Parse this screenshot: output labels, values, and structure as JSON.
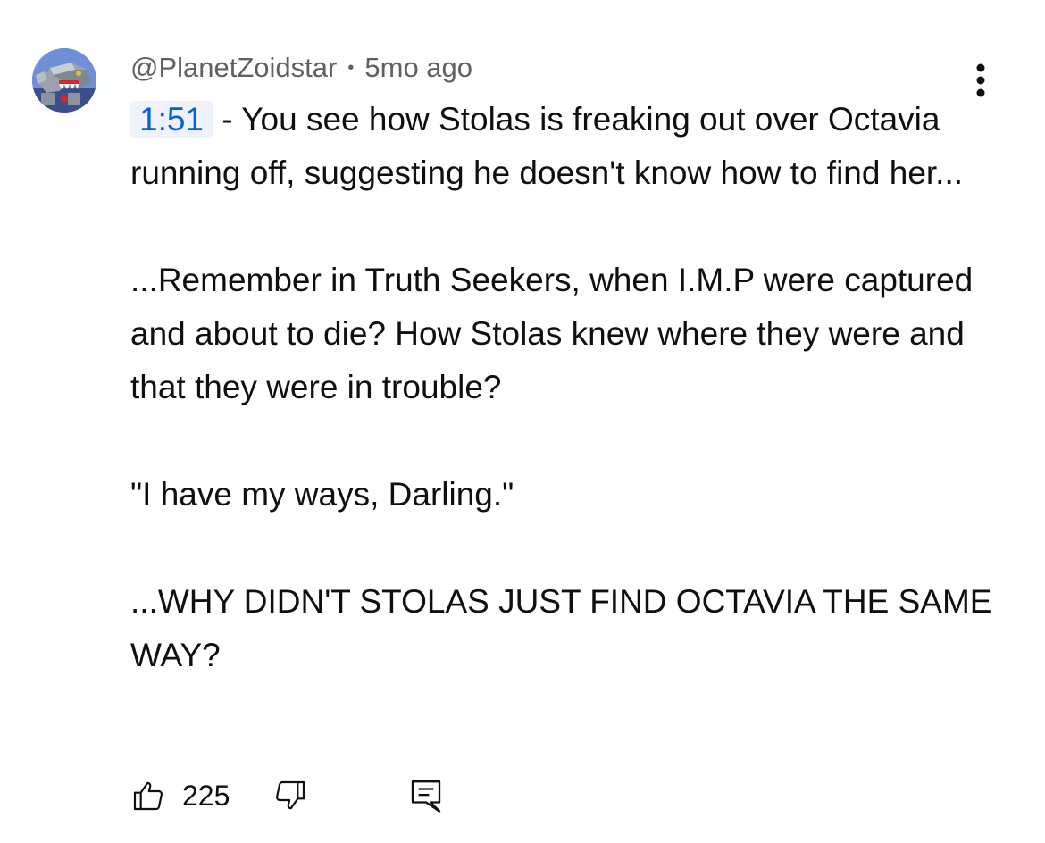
{
  "comment": {
    "author": "@PlanetZoidstar",
    "separator": "•",
    "age": "5mo ago",
    "timestamp_link": "1:51",
    "first_line_rest": " - You see how Stolas is freaking out over Octavia running off, suggesting he doesn't know how to find her...",
    "paragraph_2": "...Remember in Truth Seekers, when I.M.P were captured and about to die? How Stolas knew where they were and that they were in trouble?",
    "paragraph_3": "\"I have my ways, Darling.\"",
    "paragraph_4": "...WHY DIDN'T STOLAS JUST FIND OCTAVIA THE SAME WAY?"
  },
  "actions": {
    "like_count": "225",
    "like_icon": "thumbs-up-icon",
    "dislike_icon": "thumbs-down-icon",
    "reply_icon": "reply-comment-icon",
    "menu_icon": "more-vertical-icon"
  },
  "colors": {
    "timestamp_link": "#065fd4",
    "timestamp_bg": "#eef3fb",
    "meta_text": "#606060",
    "body_text": "#0f0f0f"
  }
}
